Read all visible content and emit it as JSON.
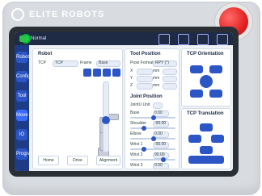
{
  "brand": {
    "name": "ELITE ROBOTS"
  },
  "ui": {
    "status": "Normal",
    "top_right": {
      "icons": [
        "new-icon",
        "home-icon",
        "open-icon",
        "save-icon"
      ]
    },
    "sidebar": [
      {
        "label": "Robot"
      },
      {
        "label": "Config"
      },
      {
        "label": "Tool"
      },
      {
        "label": "Move"
      },
      {
        "label": "IO"
      },
      {
        "label": "Program"
      }
    ],
    "robot_panel": {
      "title": "Robot",
      "tcp_label": "TCP",
      "tcp_value": "TCP",
      "frame_label": "Frame",
      "frame_value": "Base",
      "buttons": [
        "Home",
        "Drive",
        "Alignment"
      ]
    },
    "tool_position": {
      "title": "Tool Position",
      "pose_format_label": "Pose Format",
      "pose_format_value": "RPY (°)",
      "rows": [
        {
          "axis": "X",
          "value": "",
          "unit": "mm",
          "angle_value": ""
        },
        {
          "axis": "Y",
          "value": "",
          "unit": "mm",
          "angle_value": ""
        },
        {
          "axis": "Z",
          "value": "",
          "unit": "mm",
          "angle_value": ""
        }
      ]
    },
    "joint_position": {
      "title": "Joint Position",
      "unit_label": "JointU Unit",
      "rows": [
        {
          "name": "Base",
          "value": "0.00"
        },
        {
          "name": "Shoulder",
          "value": "-90.00"
        },
        {
          "name": "Elbow",
          "value": "0.00"
        },
        {
          "name": "Wrist 1",
          "value": "-90.00"
        },
        {
          "name": "Wrist 2",
          "value": "90.00"
        },
        {
          "name": "Wrist 3",
          "value": "0.00"
        }
      ]
    },
    "tcp_orientation": {
      "title": "TCP Orientation"
    },
    "tcp_translation": {
      "title": "TCP Translation"
    }
  }
}
